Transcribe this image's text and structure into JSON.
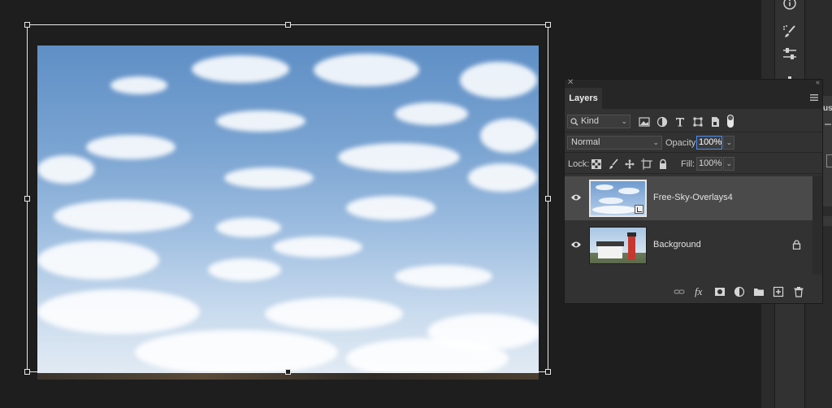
{
  "layers_panel": {
    "tab_label": "Layers",
    "filter": {
      "kind_label": "Kind"
    },
    "blend_mode": "Normal",
    "opacity": {
      "label": "Opacity:",
      "value": "100%"
    },
    "lock": {
      "label": "Lock:"
    },
    "fill": {
      "label": "Fill:",
      "value": "100%"
    },
    "layers": [
      {
        "name": "Free-Sky-Overlays4",
        "selected": true,
        "visible": true,
        "smart_object": true
      },
      {
        "name": "Background",
        "selected": false,
        "visible": true,
        "locked": true
      }
    ],
    "icons": {
      "filters": [
        "image-filter-icon",
        "adjustment-filter-icon",
        "type-filter-icon",
        "shape-filter-icon",
        "smart-object-filter-icon",
        "filter-toggle-icon"
      ],
      "lock": [
        "lock-transparent-pixels-icon",
        "lock-image-pixels-icon",
        "lock-position-icon",
        "lock-artboard-icon",
        "lock-all-icon"
      ],
      "footer": [
        "link-layers-icon",
        "fx-icon",
        "layer-mask-icon",
        "adjustment-layer-icon",
        "group-folder-icon",
        "new-layer-icon",
        "delete-layer-icon"
      ]
    }
  },
  "right_partial_panel": {
    "text_fragment": "us"
  },
  "colors": {
    "accent": "#4a8ff7",
    "panel_bg": "#323232",
    "app_bg": "#1e1e1e",
    "selected_row": "#4a4a4a"
  }
}
